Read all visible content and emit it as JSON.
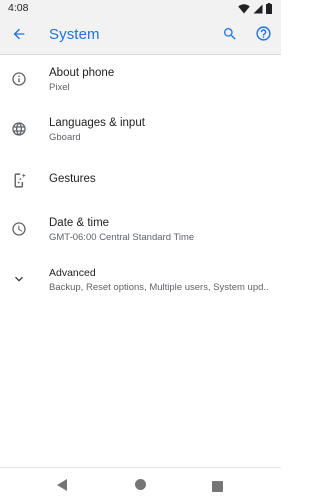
{
  "status_bar": {
    "time": "4:08",
    "icons": [
      "wifi-icon",
      "signal-icon",
      "battery-icon"
    ]
  },
  "app_bar": {
    "title": "System",
    "back_icon": "arrow-back-icon",
    "search_icon": "search-icon",
    "help_icon": "help-icon"
  },
  "items": [
    {
      "title": "About phone",
      "subtitle": "Pixel",
      "icon": "info-icon"
    },
    {
      "title": "Languages & input",
      "subtitle": "Gboard",
      "icon": "globe-icon"
    },
    {
      "title": "Gestures",
      "subtitle": "",
      "icon": "gestures-icon"
    },
    {
      "title": "Date & time",
      "subtitle": "GMT-06:00 Central Standard Time",
      "icon": "clock-icon"
    },
    {
      "title": "Advanced",
      "subtitle": "Backup, Reset options, Multiple users, System upd..",
      "icon": "chevron-down-icon"
    }
  ],
  "colors": {
    "accent": "#1a73e8",
    "icon_grey": "#5f6368",
    "text_primary": "#202124",
    "bar_bg": "#f2f2f2"
  },
  "nav_bar": {
    "icons": [
      "nav-back-icon",
      "nav-home-icon",
      "nav-recents-icon"
    ]
  }
}
